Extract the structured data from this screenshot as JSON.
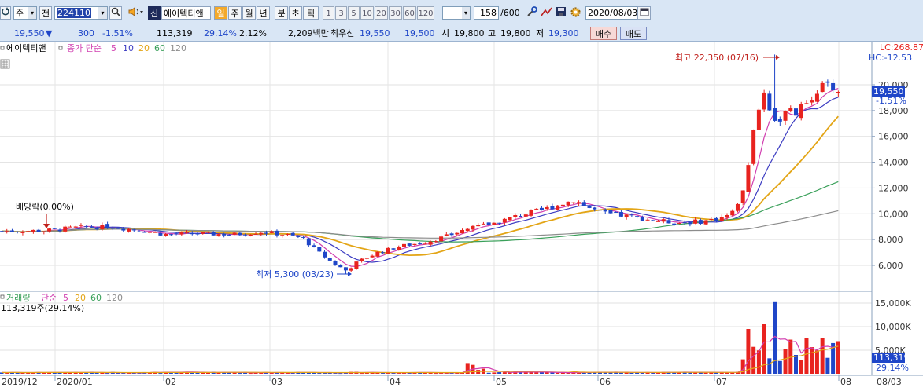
{
  "toolbar": {
    "market": "주",
    "prev_label": "전",
    "code": "224110",
    "company_name": "에이텍티앤",
    "credit_badge": "신",
    "period_buttons": [
      "일",
      "주",
      "월",
      "년",
      "분",
      "초",
      "틱"
    ],
    "interval_buttons": [
      "1",
      "3",
      "5",
      "10",
      "20",
      "30",
      "60",
      "120"
    ],
    "count": "158",
    "count_total": "/600",
    "date": "2020/08/03"
  },
  "quote": {
    "price": "19,550",
    "arrow": "▼",
    "change": "300",
    "change_pct": "-1.51%",
    "volume": "113,319",
    "vol_ratio": "29.14%",
    "turnover": "2.12%",
    "amount": "2,209백만",
    "best_label": "최우선",
    "ask": "19,550",
    "bid": "19,500",
    "open_label": "시",
    "open": "19,800",
    "high_label": "고",
    "high": "19,800",
    "low_label": "저",
    "low": "19,300",
    "buy_button": "매수",
    "sell_button": "매도"
  },
  "price_panel": {
    "stock_label": "에이텍티앤",
    "ma_label": "종가 단순",
    "ma_periods": [
      "5",
      "10",
      "20",
      "60",
      "120"
    ],
    "lc_label": "LC:268.87",
    "hc_label": "HC:-12.53",
    "high_annotation": "최고 22,350 (07/16)",
    "low_annotation": "최저 5,300 (03/23)",
    "dividend_annotation": "배당락(0.00%)",
    "current_price_tag": "19,550",
    "current_change_tag": "-1.51%",
    "y_ticks": [
      "20,000",
      "18,000",
      "16,000",
      "14,000",
      "12,000",
      "10,000",
      "8,000",
      "6,000"
    ]
  },
  "volume_panel": {
    "label": "거래량",
    "ma_label": "단순",
    "ma_periods": [
      "5",
      "20",
      "60",
      "120"
    ],
    "info": "113,319주(29.14%)",
    "y_ticks": [
      "15,000K",
      "10,000K",
      "5,000K"
    ],
    "current_tag": "113,319",
    "ratio_tag": "29.14%"
  },
  "x_axis": [
    "2019/12",
    "2020/01",
    "02",
    "03",
    "04",
    "05",
    "06",
    "07",
    "08",
    "08/03"
  ],
  "colors": {
    "up": "#e8231f",
    "down": "#1f46c8",
    "ma5": "#d13fb0",
    "ma10": "#3d3dc2",
    "ma20": "#e3a516",
    "ma60": "#3aa05a",
    "ma120": "#8c8c8c"
  },
  "chart_data": {
    "type": "candlestick",
    "title": "에이텍티앤",
    "x": [
      "2019/12",
      "2020/01",
      "02",
      "03",
      "04",
      "05",
      "06",
      "07",
      "08"
    ],
    "ylim": [
      5000,
      23000
    ],
    "volume_ylim": [
      0,
      15500
    ],
    "high": {
      "value": 22350,
      "date": "07/16"
    },
    "low": {
      "value": 5300,
      "date": "03/23"
    },
    "last": {
      "close": 19550,
      "change": -300,
      "change_pct": -1.51,
      "volume": 113319
    },
    "ma_periods": [
      5,
      10,
      20,
      60,
      120
    ]
  }
}
